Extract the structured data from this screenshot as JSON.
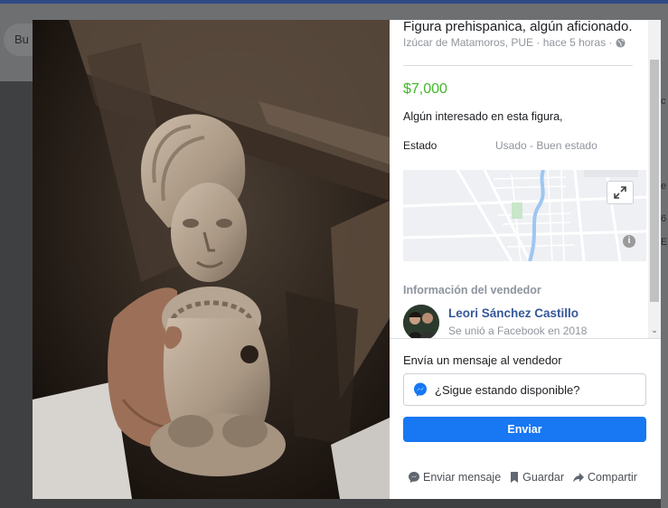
{
  "background": {
    "search_placeholder": "Bu",
    "right_edge_texts": [
      "c",
      "e",
      "6",
      "E"
    ]
  },
  "listing": {
    "title": "Figura prehispanica, algún aficionado.",
    "location_time": "Izúcar de Matamoros, PUE · hace 5 horas ·",
    "price": "$7,000",
    "description": "Algún interesado en esta figura,",
    "condition_label": "Estado",
    "condition_value": "Usado - Buen estado"
  },
  "seller": {
    "section_title": "Información del vendedor",
    "name": "Leori Sánchez Castillo",
    "joined": "Se unió a Facebook en 2018"
  },
  "message": {
    "label": "Envía un mensaje al vendedor",
    "input_value": "¿Sigue estando disponible?",
    "send_label": "Enviar"
  },
  "actions": {
    "send_message": "Enviar mensaje",
    "save": "Guardar",
    "share": "Compartir"
  },
  "icons": [
    "globe-icon",
    "expand-icon",
    "info-icon",
    "messenger-icon",
    "chat-bubble-icon",
    "bookmark-icon",
    "share-arrow-icon",
    "chevron-down-icon"
  ],
  "colors": {
    "price": "#42b72a",
    "seller_name": "#365899",
    "send_button": "#1877f2",
    "muted_text": "#90949c"
  }
}
